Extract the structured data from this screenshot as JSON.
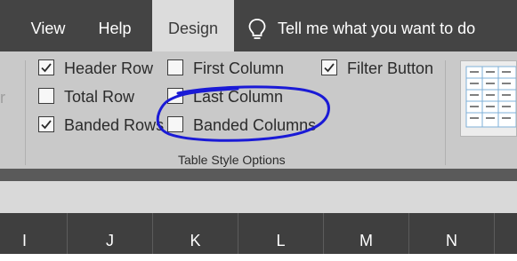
{
  "tabs": {
    "view": "View",
    "help": "Help",
    "design": "Design",
    "tell_me": "Tell me what you want to do"
  },
  "ribbon": {
    "left_partial_text": "r",
    "options": {
      "header_row": {
        "label": "Header Row",
        "checked": true
      },
      "total_row": {
        "label": "Total Row",
        "checked": false
      },
      "banded_rows": {
        "label": "Banded Rows",
        "checked": true
      },
      "first_column": {
        "label": "First Column",
        "checked": false
      },
      "last_column": {
        "label": "Last Column",
        "checked": false
      },
      "banded_columns": {
        "label": "Banded Columns",
        "checked": false
      },
      "filter_button": {
        "label": "Filter Button",
        "checked": true
      }
    },
    "group_label": "Table Style Options"
  },
  "columns": [
    "I",
    "J",
    "K",
    "L",
    "M",
    "N"
  ],
  "colors": {
    "tabbar": "#444444",
    "active_tab": "#dcdcdc",
    "ribbon": "#c9c9c9",
    "annotation": "#1a1ad6",
    "table_style_accent": "#7fb0d9"
  },
  "icons": {
    "tell_me": "lightbulb-icon",
    "checkbox_checked": "checkmark-icon"
  }
}
